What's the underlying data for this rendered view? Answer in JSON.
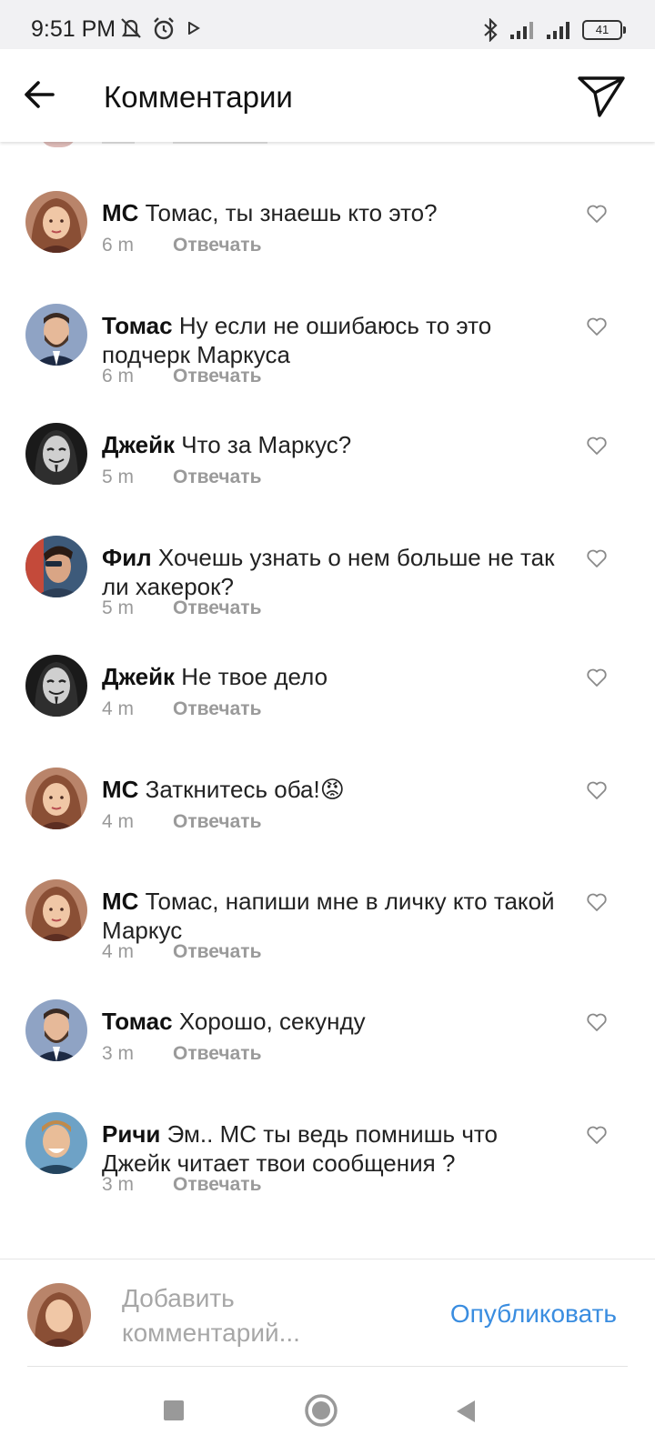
{
  "status_bar": {
    "time": "9:51 PM",
    "battery": "41",
    "icons": [
      "muted-notification-icon",
      "alarm-icon",
      "play-icon",
      "bluetooth-icon",
      "signal-icon",
      "signal-icon",
      "battery-icon"
    ]
  },
  "header": {
    "title": "Комментарии",
    "back_icon": "arrow-left-icon",
    "send_icon": "paper-plane-icon"
  },
  "comments": [
    {
      "user": "МС",
      "text": " Томас, ты знаешь кто это?",
      "time": "6 m",
      "reply": "Отвечать",
      "avatar": "woman-avatar"
    },
    {
      "user": "Томас",
      "text": " Ну если не ошибаюсь то это подчерк Маркуса",
      "time": "6 m",
      "reply": "Отвечать",
      "avatar": "man-beard-avatar"
    },
    {
      "user": "Джейк",
      "text": " Что за Маркус?",
      "time": "5 m",
      "reply": "Отвечать",
      "avatar": "mask-avatar"
    },
    {
      "user": "Фил",
      "text": " Хочешь узнать о нем больше не так ли хакерок?",
      "time": "5 m",
      "reply": "Отвечать",
      "avatar": "man-profile-avatar"
    },
    {
      "user": "Джейк",
      "text": " Не твое дело",
      "time": "4 m",
      "reply": "Отвечать",
      "avatar": "mask-avatar"
    },
    {
      "user": "МС",
      "text": " Заткнитесь оба!😡",
      "time": "4 m",
      "reply": "Отвечать",
      "avatar": "woman-avatar"
    },
    {
      "user": "МС",
      "text": " Томас, напиши мне в личку кто такой Маркус",
      "time": "4 m",
      "reply": "Отвечать",
      "avatar": "woman-avatar"
    },
    {
      "user": "Томас",
      "text": " Хорошо, секунду",
      "time": "3 m",
      "reply": "Отвечать",
      "avatar": "man-beard-avatar"
    },
    {
      "user": "Ричи",
      "text": " Эм.. МС ты ведь помнишь что Джейк читает твои сообщения ?",
      "time": "3 m",
      "reply": "Отвечать",
      "avatar": "smiling-man-avatar"
    }
  ],
  "compose": {
    "placeholder": "Добавить комментарий...",
    "publish": "Опубликовать"
  },
  "nav": [
    "recents-button",
    "home-button",
    "back-button"
  ]
}
